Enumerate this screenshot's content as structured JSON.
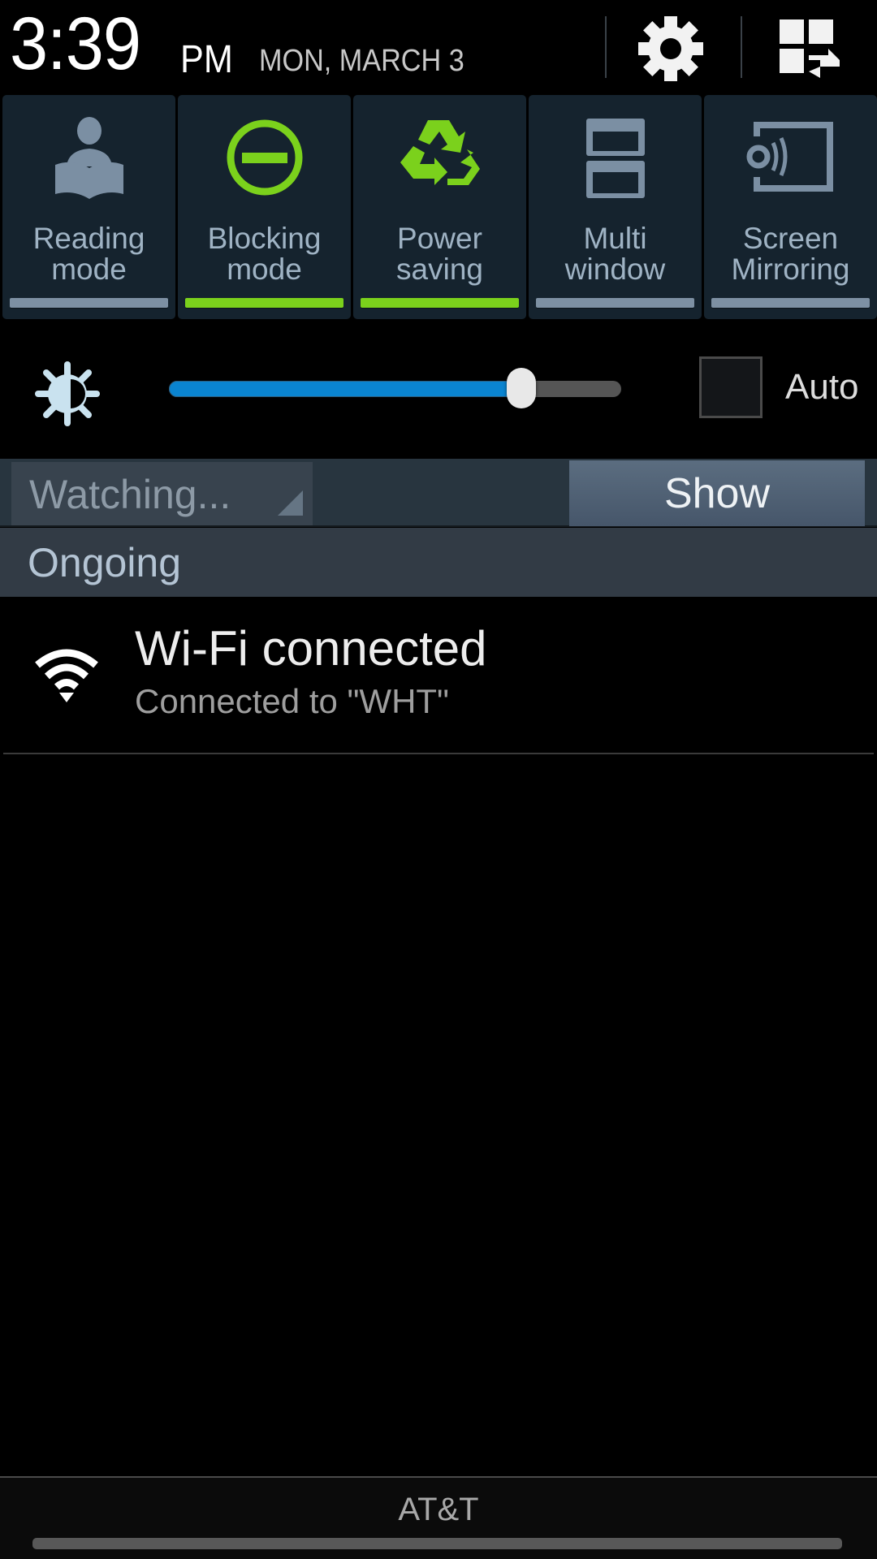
{
  "header": {
    "time": "3:39",
    "ampm": "PM",
    "date": "MON, MARCH 3",
    "settings_icon": "gear-icon",
    "edit_icon": "edit-quick-panel-icon"
  },
  "quick_toggles": [
    {
      "label": "Reading\nmode",
      "icon": "reading-person-icon",
      "active": false
    },
    {
      "label": "Blocking\nmode",
      "icon": "minus-circle-icon",
      "active": true
    },
    {
      "label": "Power\nsaving",
      "icon": "recycle-icon",
      "active": true
    },
    {
      "label": "Multi\nwindow",
      "icon": "multi-window-icon",
      "active": false
    },
    {
      "label": "Screen\nMirroring",
      "icon": "screen-mirroring-icon",
      "active": false
    }
  ],
  "colors": {
    "active": "#7bd11c",
    "inactive": "#7d90a3",
    "slider_fill": "#0a84d0"
  },
  "brightness": {
    "icon": "brightness-icon",
    "level": 0.78,
    "auto_label": "Auto",
    "auto_checked": false
  },
  "watch_on": {
    "spinner_value": "Watching...",
    "show_label": "Show"
  },
  "ongoing": {
    "header": "Ongoing",
    "notifications": [
      {
        "icon": "wifi-icon",
        "title": "Wi-Fi connected",
        "subtitle": "Connected to \"WHT\""
      }
    ]
  },
  "footer": {
    "carrier": "AT&T"
  }
}
